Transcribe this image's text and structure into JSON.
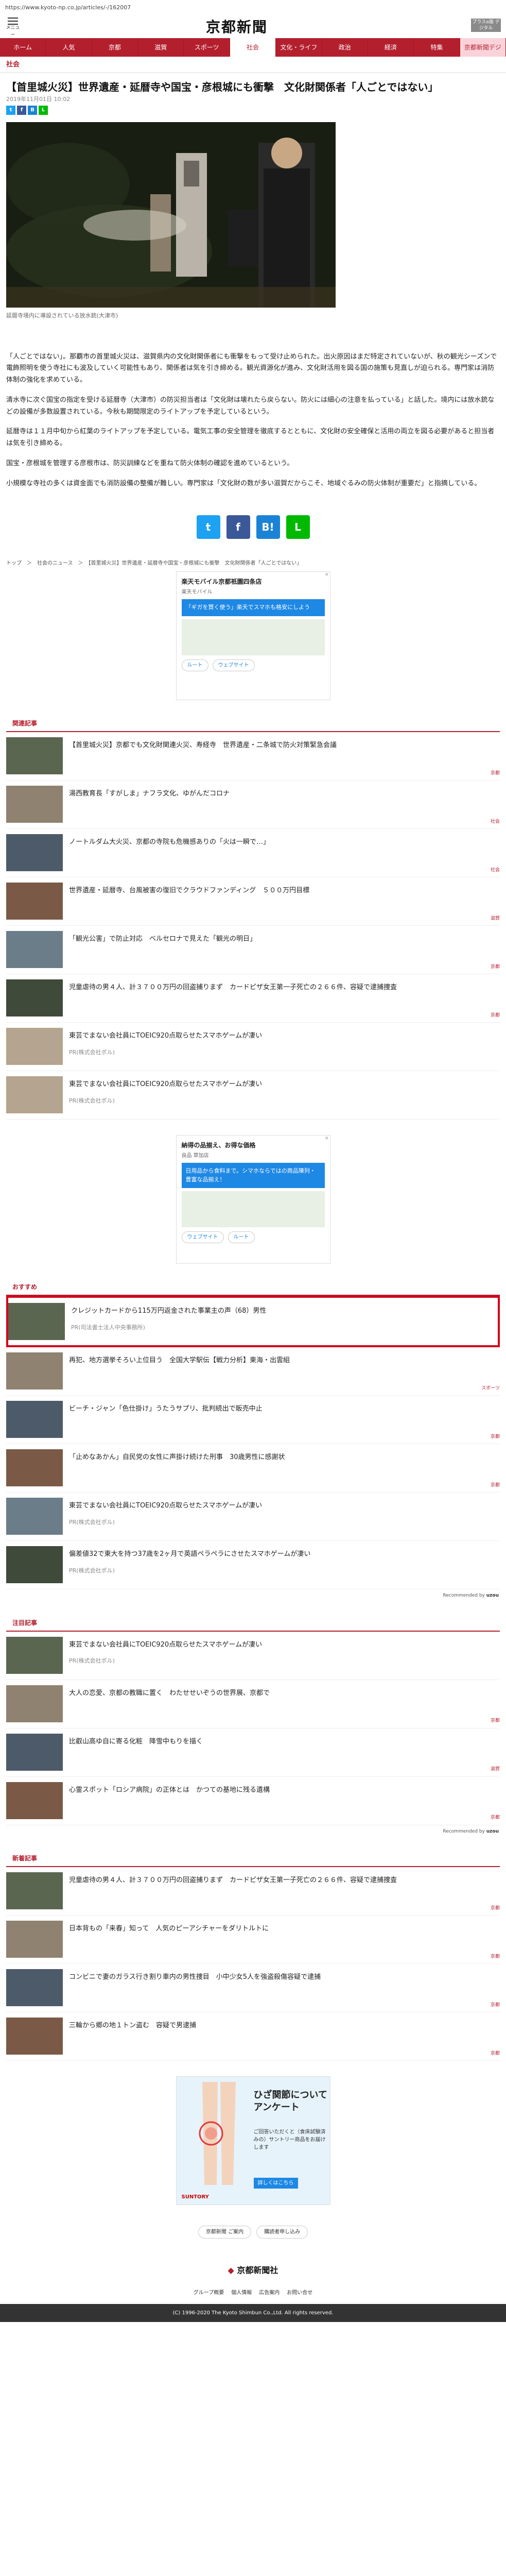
{
  "url": "https://www.kyoto-np.co.jp/articles/-/162007",
  "header": {
    "menu_label": "メニュー",
    "logo": "京都新聞",
    "premium_label": "プラスα版\nデジタル"
  },
  "nav": [
    "ホーム",
    "人気",
    "京都",
    "滋賀",
    "スポーツ",
    "社会",
    "文化・ライフ",
    "政治",
    "経済",
    "特集",
    "京都新聞デジ"
  ],
  "nav_active": 5,
  "section": "社会",
  "article": {
    "title": "【首里城火災】世界遺産・延暦寺や国宝・彦根城にも衝撃　文化財関係者「人ごとではない」",
    "date": "2019年11月01日 10:02",
    "caption": "延暦寺境内に導設されている放水銃(大津市)",
    "paragraphs": [
      "「人ごとではない」。那覇市の首里城火災は、滋賀県内の文化財関係者にも衝撃をもって受け止められた。出火原因はまだ特定されていないが、秋の観光シーズンで電飾照明を使う寺社にも波及していく可能性もあり、関係者は気を引き締める。観光資源化が進み、文化財活用を図る国の施策も見直しが迫られる。専門家は消防体制の強化を求めている。",
      "清水寺に次ぐ国宝の指定を受ける延暦寺（大津市）の防災担当者は「文化財は壊れたら戻らない。防火には細心の注意を払っている」と話した。境内には放水銃などの設備が多数設置されている。今秋も期間限定のライトアップを予定しているという。",
      "延暦寺は１１月中旬から紅葉のライトアップを予定している。電気工事の安全管理を徹底するとともに、文化財の安全確保と活用の両立を図る必要があると担当者は気を引き締める。",
      "国宝・彦根城を管理する彦根市は、防災訓練などを重ねて防火体制の確認を進めているという。",
      "小規模な寺社の多くは資金面でも消防設備の整備が難しい。専門家は「文化財の数が多い滋賀だからこそ、地域ぐるみの防火体制が重要だ」と指摘している。"
    ],
    "breadcrumb": "トップ　＞　社会のニュース　＞　【首里城火災】世界遺産・延暦寺や国宝・彦根城にも衝撃　文化財関係者「人ごとではない」"
  },
  "ad1": {
    "title": "楽天モバイル京都祇園四条店",
    "sub": "楽天モバイル",
    "banner": "「ギガを賢く使う」楽天でスマホも格安にしよう",
    "route": "ルート",
    "web": "ウェブサイト"
  },
  "related": {
    "heading": "関連記事",
    "items": [
      {
        "title": "【首里城火災】京都でも文化財関連火災、寿経寺　世界遺産・二条城で防火対策緊急会議",
        "cat": "京都"
      },
      {
        "title": "湯西教育長「すがしま」ナフラ文化、ゆがんだコロナ",
        "cat": "社会"
      },
      {
        "title": "ノートルダム大火災、京都の寺院も危機感ありの「火は一瞬で…」",
        "cat": "社会"
      },
      {
        "title": "世界遺産・延暦寺、台風被害の復旧でクラウドファンディング　５００万円目標",
        "cat": "滋賀"
      },
      {
        "title": "「観光公害」で防止対応　ベルセロナで見えた「観光の明日」",
        "cat": "京都"
      },
      {
        "title": "児童虐待の男４人、計３７００万円の回盗捕りまず　カードピザ女王第一子死亡の２６６件、容疑で逮捕捜査",
        "cat": "京都"
      }
    ],
    "pr": [
      {
        "title": "東芸でまない会社員にTOEIC920点取らせたスマホゲームが凄い",
        "src": "PR(株式会社ポル)"
      },
      {
        "title": "東芸でまない会社員にTOEIC920点取らせたスマホゲームが凄い",
        "src": "PR(株式会社ポル)"
      }
    ]
  },
  "ad2": {
    "title": "納得の品揃え、お得な価格",
    "sub": "良品 草加店",
    "banner": "日用品から食料まで。シマホならではの商品陳列・豊富な品揃え！",
    "web": "ウェブサイト",
    "route": "ルート"
  },
  "recommend": {
    "heading": "おすすめ",
    "items": [
      {
        "title": "クレジットカードから115万円返金された事業主の声（68）男性",
        "src": "PR(司法書士法人中央事務所)",
        "highlight": true
      },
      {
        "title": "再犯、地方選挙そろい上位目う　全国大学駅伝【戦力分析】東海・出雲組",
        "cat": "スポーツ"
      },
      {
        "title": "ビーチ・ジャン「色仕掛け」うたうサプリ、批判続出で販売中止",
        "cat": "京都"
      },
      {
        "title": "「止めなあかん」自民党の女性に声掛け続けた刑事　30歳男性に感謝状",
        "cat": "京都"
      },
      {
        "title": "東芸でまない会社員にTOEIC920点取らせたスマホゲームが凄い",
        "src": "PR(株式会社ポル)"
      },
      {
        "title": "偏差値32で東大を持つ37歳を2ヶ月で英語ペラペラにさせたスマホゲームが凄い",
        "src": "PR(株式会社ポル)"
      }
    ],
    "powered": "Recommended by"
  },
  "popular": {
    "heading": "注目記事",
    "items": [
      {
        "title": "東芸でまない会社員にTOEIC920点取らせたスマホゲームが凄い",
        "src": "PR(株式会社ポル)"
      },
      {
        "title": "大人の恋愛、京都の教職に置く　わたせせいぞうの世界展、京都で",
        "cat": "京都"
      },
      {
        "title": "比叡山高ゆ自に寄る化粧　降雪中もりを描く",
        "cat": "滋賀"
      },
      {
        "title": "心霊スポット「ロシア病院」の正体とは　かつての基地に残る遺構",
        "cat": "京都"
      }
    ],
    "powered": "Recommended by"
  },
  "latest": {
    "heading": "新着記事",
    "items": [
      {
        "title": "児童虐待の男４人、計３７００万円の回盗捕りまず　カードピザ女王第一子死亡の２６６件、容疑で逮捕捜査",
        "cat": "京都"
      },
      {
        "title": "日本背もの「来春」知って　人気のピーアシチャーをダリトルトに",
        "cat": "京都"
      },
      {
        "title": "コンビニで妻のガラス行き割り車内の男性捜目　小中少女5人を強盗殺傷容疑で逮捕",
        "cat": "京都"
      },
      {
        "title": "三輪から郷の地１トン盗む　容疑で男逮捕",
        "cat": "京都"
      }
    ]
  },
  "ad3": {
    "title": "ひざ関節について アンケート",
    "body": "ご回答いただくと（食床試験済みの）サントリー商品をお届けします",
    "cta": "詳しくはこちら",
    "brand": "SUNTORY"
  },
  "footer_buttons": [
    "京都新聞 ご案内",
    "購読者申し込み"
  ],
  "footer_logo": "京都新聞社",
  "footer_links": [
    "グループ概要",
    "個人情報",
    "広告案内",
    "お問い合せ"
  ],
  "copyright": "(C) 1996-2020 The Kyoto Shimbun Co.,Ltd. All rights reserved."
}
